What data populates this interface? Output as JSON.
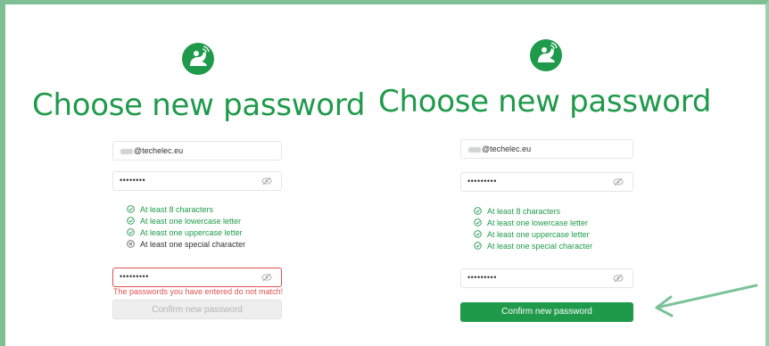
{
  "left_panel": {
    "logo_icon": "leaf-cat-logo-icon",
    "title": "Choose new password",
    "email_value": "@techelec.eu",
    "password_dots": "••••••••",
    "eye_icon": "eye-slash-icon",
    "rules": [
      {
        "label": "At least 8 characters",
        "status": "pass",
        "icon": "check-circle-icon"
      },
      {
        "label": "At least one lowercase letter",
        "status": "pass",
        "icon": "check-circle-icon"
      },
      {
        "label": "At least one uppercase letter",
        "status": "pass",
        "icon": "check-circle-icon"
      },
      {
        "label": "At least one special character",
        "status": "fail",
        "icon": "x-circle-icon"
      }
    ],
    "confirm_dots": "•••••••••",
    "error_message": "The passwords you have entered do not match!",
    "button_label": "Confirm new password",
    "button_state": "disabled"
  },
  "right_panel": {
    "logo_icon": "leaf-cat-logo-icon",
    "title": "Choose new password",
    "email_value": "@techelec.eu",
    "password_dots": "•••••••••",
    "eye_icon": "eye-slash-icon",
    "rules": [
      {
        "label": "At least 8 characters",
        "status": "pass",
        "icon": "check-circle-icon"
      },
      {
        "label": "At least one lowercase letter",
        "status": "pass",
        "icon": "check-circle-icon"
      },
      {
        "label": "At least one uppercase letter",
        "status": "pass",
        "icon": "check-circle-icon"
      },
      {
        "label": "At least one special character",
        "status": "pass",
        "icon": "check-circle-icon"
      }
    ],
    "confirm_dots": "•••••••••",
    "button_label": "Confirm new password",
    "button_state": "enabled"
  },
  "colors": {
    "brand_green": "#1f9a4b",
    "error_red": "#e05050",
    "frame_green": "#7fbf94",
    "arrow_green": "#7cc39a"
  },
  "annotation": {
    "icon": "arrow-pointing-left-icon"
  }
}
